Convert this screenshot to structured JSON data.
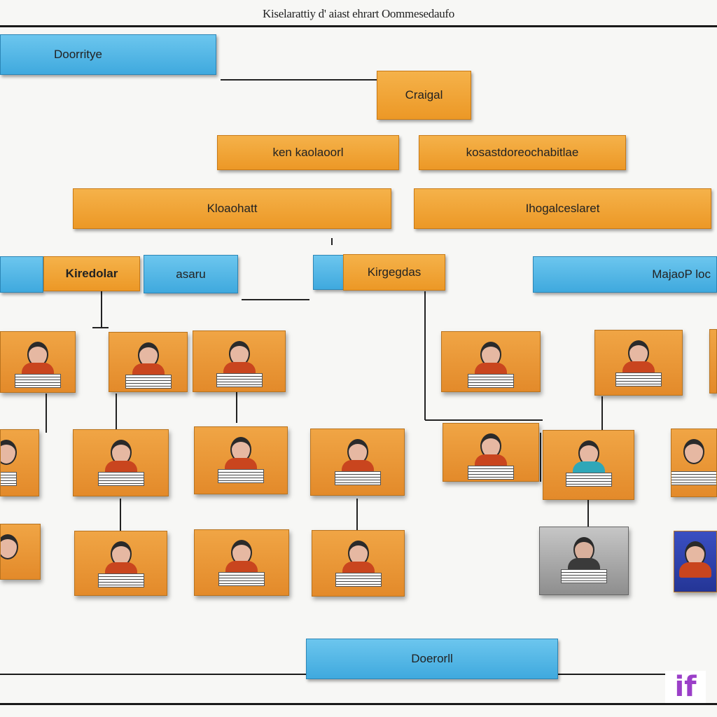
{
  "title": "Kiselarattiy d' aiast ehrart Oommesedaufo",
  "boxes": {
    "top_left": "Doorritye",
    "root": "Craigal",
    "l2_left": "ken kaolaoorl",
    "l2_right": "kosastdoreochabitlae",
    "l3_left": "Kloaohatt",
    "l3_right": "Ihogalceslaret",
    "dept_a": "Kiredolar",
    "dept_a_side": "asaru",
    "dept_b": "Kirgegdas",
    "dept_c": "MajaoP loc",
    "bottom": "Doerorll"
  },
  "logo_text": "if",
  "colors": {
    "orange": "#ec9826",
    "blue": "#3fa9de",
    "line": "#1a1a1a"
  }
}
